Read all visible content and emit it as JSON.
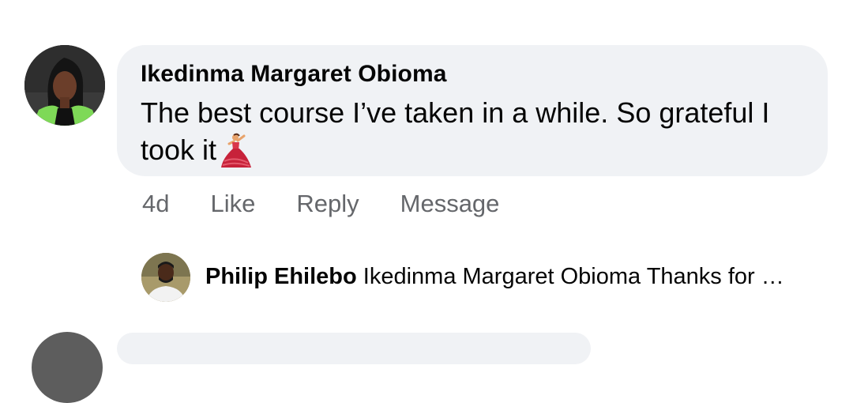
{
  "comment": {
    "author": "Ikedinma Margaret Obioma",
    "text": "The best course I’ve taken in a while. So grateful I took it",
    "emoji": "dancer-emoji",
    "timestamp": "4d",
    "actions": {
      "like": "Like",
      "reply": "Reply",
      "message": "Message"
    }
  },
  "reply": {
    "author": "Philip Ehilebo",
    "text": "Ikedinma Margaret Obioma Thanks for …"
  },
  "colors": {
    "bubble": "#f0f2f5",
    "secondary_text": "#65676b",
    "primary_text": "#050505"
  }
}
